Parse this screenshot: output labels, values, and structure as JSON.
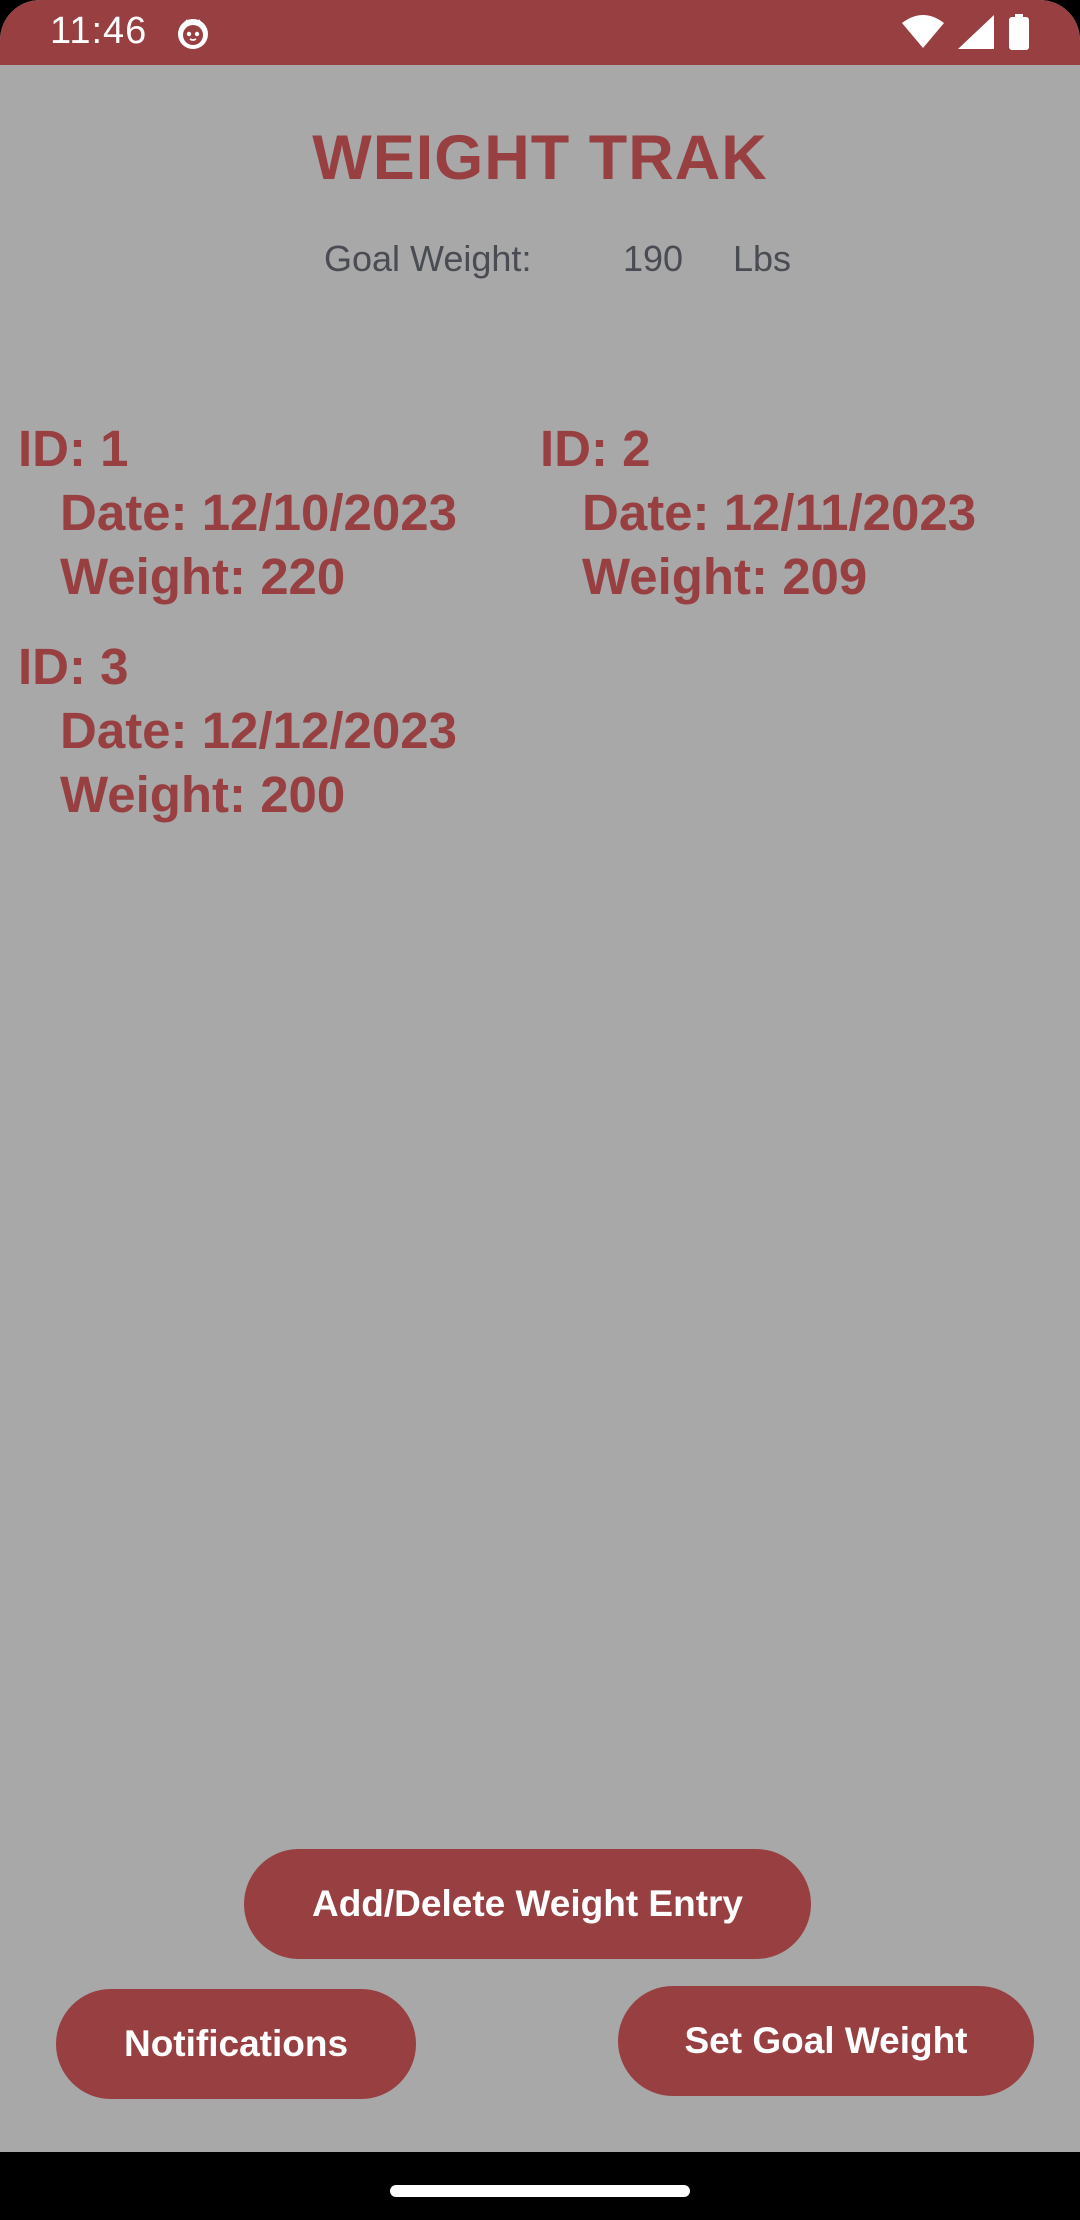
{
  "status_bar": {
    "time": "11:46",
    "icons": [
      "cat-icon",
      "wifi-icon",
      "cell-signal-icon",
      "battery-icon"
    ],
    "color": "#983f42"
  },
  "app": {
    "title": "WEIGHT TRAK"
  },
  "goal": {
    "label": "Goal Weight:",
    "value": "190",
    "unit": "Lbs"
  },
  "entries": [
    {
      "id": "ID: 1",
      "date": "Date: 12/10/2023",
      "weight": "Weight: 220"
    },
    {
      "id": "ID: 2",
      "date": "Date: 12/11/2023",
      "weight": "Weight: 209"
    },
    {
      "id": "ID: 3",
      "date": "Date: 12/12/2023",
      "weight": "Weight: 200"
    }
  ],
  "buttons": {
    "add_delete": "Add/Delete Weight Entry",
    "notifications": "Notifications",
    "set_goal": "Set Goal Weight"
  },
  "colors": {
    "accent": "#983f42",
    "background": "#a8a8a8",
    "goal_text": "#4a4c53"
  }
}
